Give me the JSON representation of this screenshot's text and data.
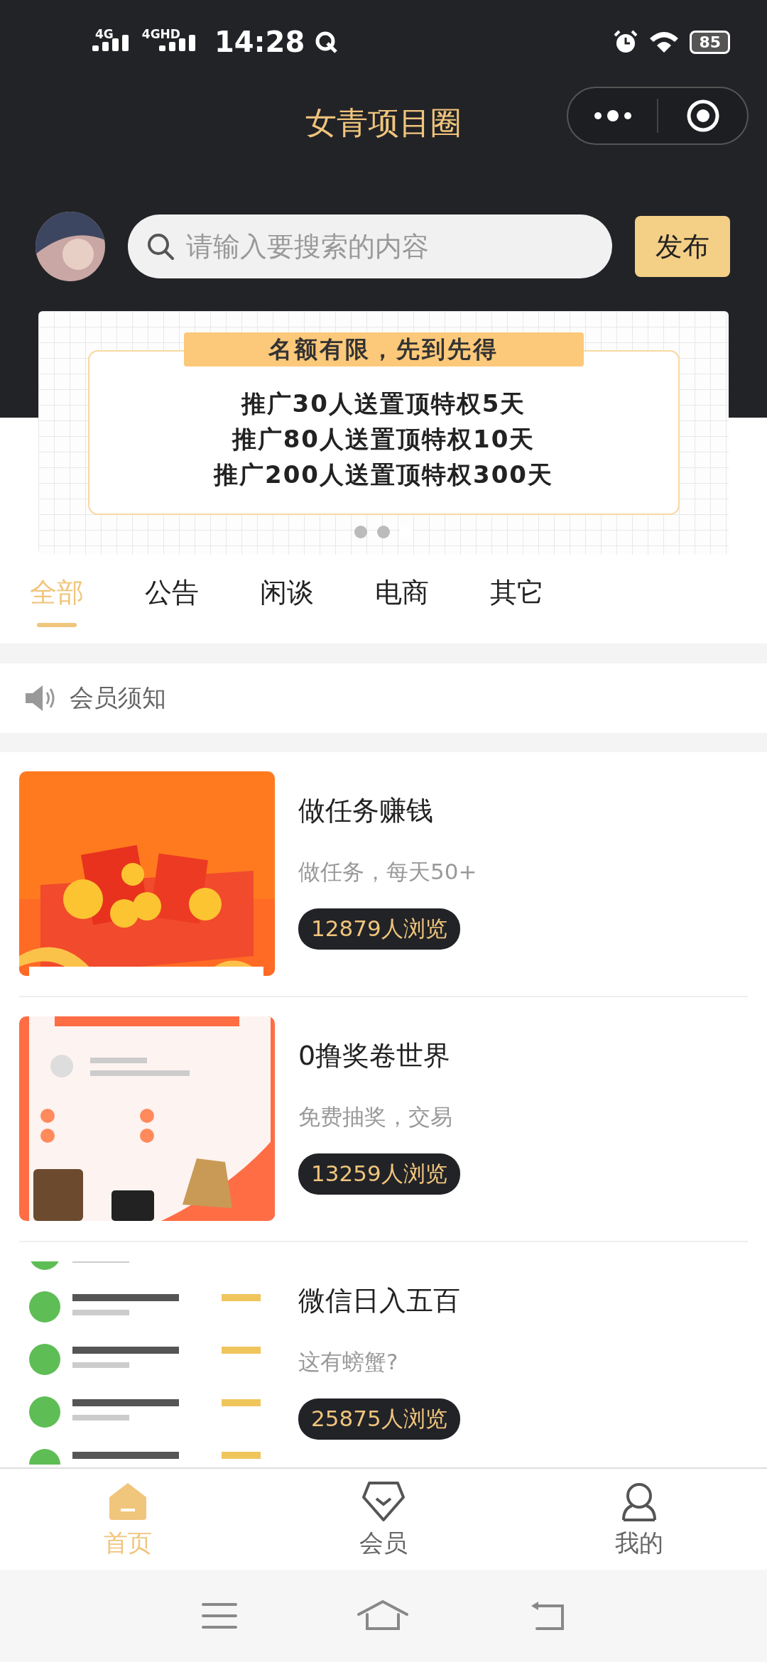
{
  "status_bar": {
    "network_1": "4G",
    "network_2": "4GHD",
    "time": "14:28",
    "battery": "85"
  },
  "header": {
    "title": "女青项目圈"
  },
  "search": {
    "placeholder": "请输入要搜索的内容",
    "publish_button": "发布"
  },
  "banner": {
    "heading": "名额有限，先到先得",
    "lines": [
      "推广30人送置顶特权5天",
      "推广80人送置顶特权10天",
      "推广200人送置顶特权300天"
    ],
    "dots": [
      {
        "selected": false
      },
      {
        "selected": false
      },
      {
        "selected": true
      }
    ]
  },
  "tabs": [
    {
      "label": "全部",
      "selected": true
    },
    {
      "label": "公告",
      "selected": false
    },
    {
      "label": "闲谈",
      "selected": false
    },
    {
      "label": "电商",
      "selected": false
    },
    {
      "label": "其它",
      "selected": false
    }
  ],
  "notice": {
    "label": "会员须知"
  },
  "posts": [
    {
      "title": "做任务赚钱",
      "subtitle": "做任务，每天50+",
      "views": "12879人浏览"
    },
    {
      "title": "0撸奖卷世界",
      "subtitle": "免费抽奖，交易",
      "views": "13259人浏览"
    },
    {
      "title": "微信日入五百",
      "subtitle": "这有螃蟹?",
      "views": "25875人浏览"
    }
  ],
  "bottom_nav": [
    {
      "label": "首页",
      "selected": true
    },
    {
      "label": "会员",
      "selected": false
    },
    {
      "label": "我的",
      "selected": false
    }
  ]
}
